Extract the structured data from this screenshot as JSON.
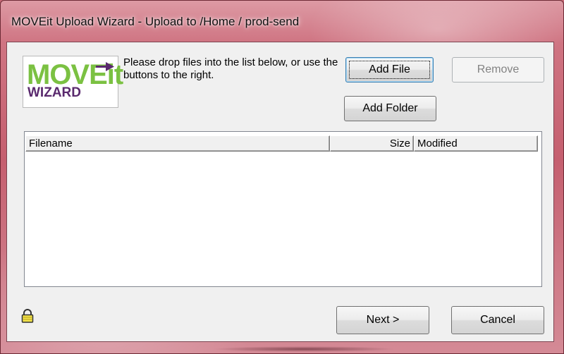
{
  "window": {
    "title": "MOVEit Upload Wizard - Upload to /Home / prod-send"
  },
  "logo": {
    "line1": "MOVEit",
    "line2": "WIZARD"
  },
  "instructions": {
    "text": "Please drop files into the list below, or use the buttons to the right."
  },
  "buttons": {
    "add_file": "Add File",
    "remove": "Remove",
    "add_folder": "Add Folder",
    "next": "Next >",
    "cancel": "Cancel"
  },
  "file_list": {
    "columns": [
      "Filename",
      "Size",
      "Modified"
    ],
    "rows": []
  },
  "icons": {
    "lock": "lock-icon"
  },
  "colors": {
    "logo_green": "#7bc142",
    "logo_purple": "#5a2a6e",
    "frame_tint": "#c96a78"
  }
}
